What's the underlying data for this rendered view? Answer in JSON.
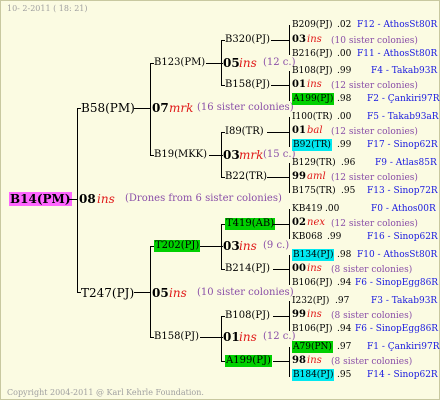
{
  "header": "10-  2-2011 ( 18: 21)",
  "footer": "Copyright 2004-2011 @ Karl Kehrle Foundation.",
  "colors": {
    "background": "#fbfbe2",
    "root": "#ff66ff",
    "green": "#00d000",
    "cyan": "#00e8f0",
    "sisters": "#8a4fa8",
    "location": "#1a1ae0",
    "mark": "#e01818"
  },
  "root": {
    "label": "B14(PM)",
    "gen": "08",
    "mark": "ins",
    "sisters": "(Drones from 6 sister colonies)"
  },
  "gen1": [
    {
      "label": "B58(PM)"
    },
    {
      "label": "T247(PJ)",
      "gen": "05",
      "mark": "ins",
      "sisters": "(10 sister colonies)"
    }
  ],
  "b58": {
    "gen": "07",
    "mark": "mrk",
    "sisters": "(16 sister colonies)"
  },
  "gen2": [
    {
      "label": "B123(PM)",
      "gen": "05",
      "mark": "ins",
      "sisters": "(12 c.)"
    },
    {
      "label": "B19(MKK)",
      "gen": "03",
      "mark": "mrk",
      "sisters": "(15 c.)"
    },
    {
      "label": "T202(PJ)",
      "gen": "03",
      "mark": "ins",
      "sisters": "(9 c.)"
    },
    {
      "label": "B158(PJ)",
      "gen": "01",
      "mark": "ins",
      "sisters": "(12 c.)"
    }
  ],
  "gen3": [
    {
      "label": "B320(PJ)"
    },
    {
      "label": "B158(PJ)"
    },
    {
      "label": "I89(TR)"
    },
    {
      "label": "B22(TR)"
    },
    {
      "label": "T419(AB)"
    },
    {
      "label": "B214(PJ)"
    },
    {
      "label": "B108(PJ)"
    },
    {
      "label": "A199(PJ)"
    }
  ],
  "rows": [
    {
      "label": "B209(PJ)",
      "pct": ".02",
      "loc": "F12 - AthosSt80R"
    },
    {
      "gen": "03",
      "mark": "ins",
      "sisters": "(10 sister colonies)"
    },
    {
      "label": "B216(PJ)",
      "pct": ".00",
      "loc": "F11 - AthosSt80R"
    },
    {
      "label": "B108(PJ)",
      "pct": ".99",
      "loc": "F4 - Takab93R"
    },
    {
      "gen": "01",
      "mark": "ins",
      "sisters": "(12 sister colonies)"
    },
    {
      "label": "A199(PJ)",
      "pct": ".98",
      "loc": "F2 - Çankiri97R"
    },
    {
      "label": "I100(TR)",
      "pct": ".00",
      "loc": "F5 - Takab93aR"
    },
    {
      "gen": "01",
      "mark": "bal",
      "sisters": "(12 sister colonies)"
    },
    {
      "label": "B92(TR)",
      "pct": ".99",
      "loc": "F17 - Sinop62R"
    },
    {
      "label": "B129(TR)",
      "pct": ".96",
      "loc": "F9 - Atlas85R"
    },
    {
      "gen": "99",
      "mark": "aml",
      "sisters": "(12 sister colonies)"
    },
    {
      "label": "B175(TR)",
      "pct": ".95",
      "loc": "F13 - Sinop72R"
    },
    {
      "label": "KB419",
      "pct": ".00",
      "loc": "F0 - Athos00R"
    },
    {
      "gen": "02",
      "mark": "nex",
      "sisters": "(12 sister colonies)"
    },
    {
      "label": "KB068",
      "pct": ".99",
      "loc": "F16 - Sinop62R"
    },
    {
      "label": "B134(PJ)",
      "pct": ".98",
      "loc": "F10 - AthosSt80R"
    },
    {
      "gen": "00",
      "mark": "ins",
      "sisters": "(8 sister colonies)"
    },
    {
      "label": "B106(PJ)",
      "pct": ".94",
      "loc": "F6 - SinopEgg86R"
    },
    {
      "label": "I232(PJ)",
      "pct": ".97",
      "loc": "F3 - Takab93R"
    },
    {
      "gen": "99",
      "mark": "ins",
      "sisters": "(8 sister colonies)"
    },
    {
      "label": "B106(PJ)",
      "pct": ".94",
      "loc": "F6 - SinopEgg86R"
    },
    {
      "label": "A79(PN)",
      "pct": ".97",
      "loc": "F1 - Çankiri97R"
    },
    {
      "gen": "98",
      "mark": "ins",
      "sisters": "(8 sister colonies)"
    },
    {
      "label": "B184(PJ)",
      "pct": ".95",
      "loc": "F14 - Sinop62R"
    }
  ]
}
